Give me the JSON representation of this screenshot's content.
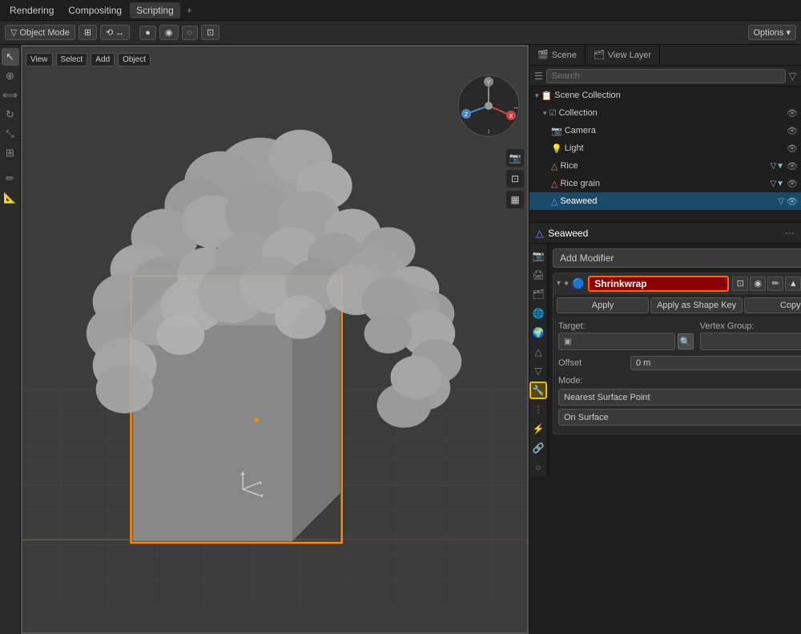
{
  "topbar": {
    "tabs": [
      {
        "label": "Rendering",
        "active": false
      },
      {
        "label": "Compositing",
        "active": false
      },
      {
        "label": "Scripting",
        "active": true
      }
    ],
    "plus_label": "+"
  },
  "toolbar": {
    "options_label": "Options ▾"
  },
  "viewport": {
    "object_name": "Seaweed",
    "navigation_axes": [
      "X",
      "Y",
      "Z"
    ]
  },
  "scene_tabs": {
    "scene_tab": "Scene",
    "view_layer_tab": "View Layer"
  },
  "outliner": {
    "search_placeholder": "Search",
    "items": [
      {
        "name": "Scene Collection",
        "depth": 0,
        "icon": "📋",
        "expanded": true,
        "eye": true
      },
      {
        "name": "Collection",
        "depth": 1,
        "icon": "📁",
        "expanded": true,
        "eye": true
      },
      {
        "name": "Camera",
        "depth": 2,
        "icon": "📷",
        "eye": true
      },
      {
        "name": "Light",
        "depth": 2,
        "icon": "💡",
        "eye": true
      },
      {
        "name": "Rice",
        "depth": 2,
        "icon": "△",
        "eye": true,
        "extra": "▽▼"
      },
      {
        "name": "Rice grain",
        "depth": 2,
        "icon": "△",
        "eye": true,
        "extra": "▽▼"
      },
      {
        "name": "Seaweed",
        "depth": 2,
        "icon": "△",
        "selected": true,
        "eye": true,
        "extra": "▽"
      }
    ]
  },
  "properties": {
    "object_name": "Seaweed",
    "icons": [
      {
        "name": "scene",
        "symbol": "🎬"
      },
      {
        "name": "view-layer",
        "symbol": "🗂"
      },
      {
        "name": "object-data",
        "symbol": "△"
      },
      {
        "name": "modifier",
        "symbol": "🔧",
        "active": true
      },
      {
        "name": "particles",
        "symbol": "⋮"
      },
      {
        "name": "physics",
        "symbol": "⚡"
      },
      {
        "name": "object-constraint",
        "symbol": "🔗"
      },
      {
        "name": "material",
        "symbol": "○"
      }
    ],
    "add_modifier_label": "Add Modifier",
    "modifier": {
      "name": "Shrinkwrap",
      "type_icon": "🔵",
      "apply_label": "Apply",
      "apply_shape_key_label": "Apply as Shape Key",
      "copy_label": "Copy",
      "target_label": "Target:",
      "vertex_group_label": "Vertex Group:",
      "offset_label": "Offset",
      "offset_value": "0 m",
      "mode_label": "Mode:",
      "mode_value": "Nearest Surface Point",
      "snap_mode_label": "",
      "snap_mode_value": "On Surface"
    }
  }
}
